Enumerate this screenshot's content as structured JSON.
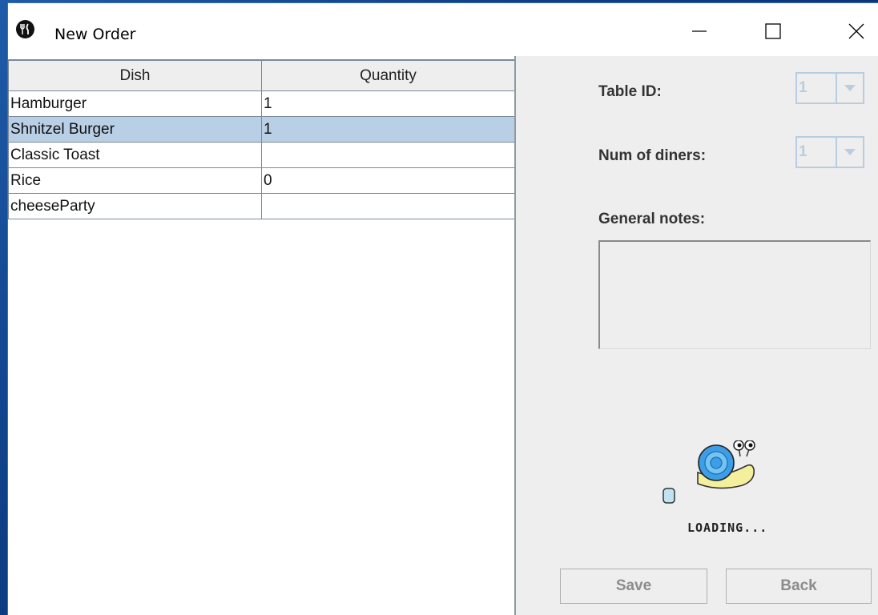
{
  "window": {
    "title": "New Order"
  },
  "table": {
    "columns": [
      "Dish",
      "Quantity"
    ],
    "rows": [
      {
        "dish": "Hamburger",
        "quantity": "1"
      },
      {
        "dish": "Shnitzel Burger",
        "quantity": "1"
      },
      {
        "dish": "Classic Toast",
        "quantity": ""
      },
      {
        "dish": "Rice",
        "quantity": "0"
      },
      {
        "dish": "cheeseParty",
        "quantity": ""
      }
    ],
    "selected_row": 1
  },
  "form": {
    "table_id_label": "Table ID:",
    "table_id_value": "1",
    "diners_label": "Num of diners:",
    "diners_value": "1",
    "notes_label": "General notes:",
    "notes_value": ""
  },
  "loading": {
    "text": "LOADING..."
  },
  "buttons": {
    "save": "Save",
    "back": "Back"
  },
  "icons": {
    "app": "utensils-icon",
    "minimize": "minimize-icon",
    "maximize": "maximize-icon",
    "close": "close-icon",
    "dropdown": "chevron-down-icon",
    "loading": "snail-icon"
  },
  "colors": {
    "selected_row": "#b8cfe5",
    "disabled_combo": "#b8cde0",
    "desktop": "#0f3f86"
  }
}
